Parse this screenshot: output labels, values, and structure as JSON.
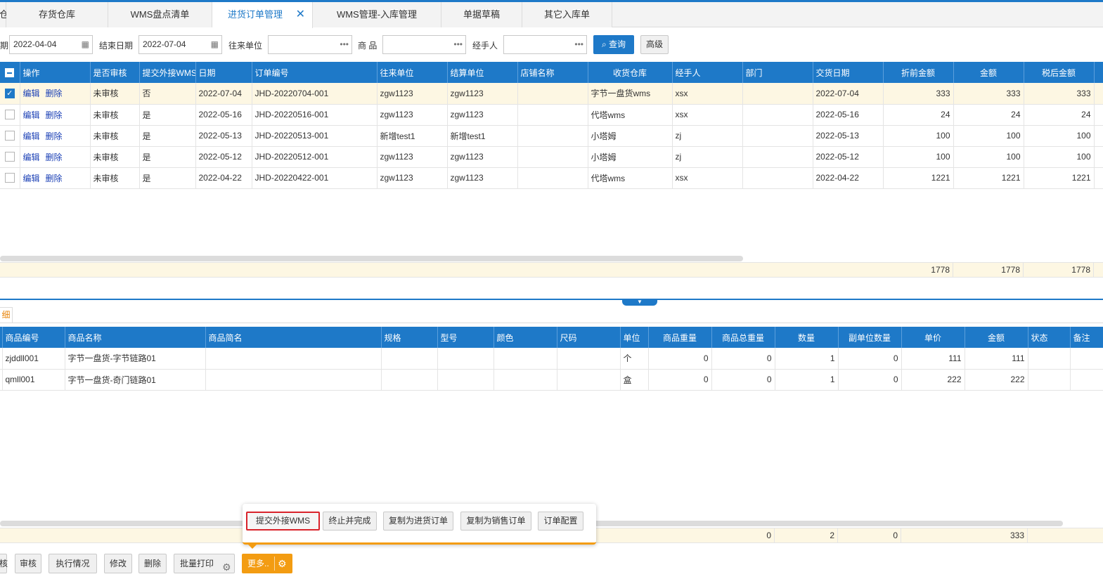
{
  "tabs": [
    {
      "label": "存货仓库"
    },
    {
      "label": "WMS盘点清单"
    },
    {
      "label": "进货订单管理",
      "close": "✕"
    },
    {
      "label": "WMS管理-入库管理"
    },
    {
      "label": "单据草稿"
    },
    {
      "label": "其它入库单"
    }
  ],
  "tab_partial": "仓",
  "filter": {
    "start_label": "期",
    "start_date": "2022-04-04",
    "end_label": "结束日期",
    "end_date": "2022-07-04",
    "partner_label": "往来单位",
    "goods_label": "商 品",
    "handler_label": "经手人",
    "query_label": "查询",
    "advanced_label": "高级"
  },
  "main_grid": {
    "headers": [
      "操作",
      "是否审核",
      "提交外接WMS",
      "日期",
      "订单编号",
      "往来单位",
      "结算单位",
      "店铺名称",
      "收货仓库",
      "经手人",
      "部门",
      "交货日期",
      "折前金额",
      "金额",
      "税后金额"
    ],
    "edit_label": "编辑",
    "delete_label": "删除",
    "rows": [
      {
        "checked": true,
        "audit": "未审核",
        "wms": "否",
        "date": "2022-07-04",
        "order_no": "JHD-20220704-001",
        "partner": "zgw1123",
        "settle": "zgw1123",
        "shop": "",
        "warehouse": "字节一盘货wms",
        "handler": "xsx",
        "dept": "",
        "delivery": "2022-07-04",
        "pre_amount": "333",
        "amount": "333",
        "tax_amount": "333"
      },
      {
        "checked": false,
        "audit": "未审核",
        "wms": "是",
        "date": "2022-05-16",
        "order_no": "JHD-20220516-001",
        "partner": "zgw1123",
        "settle": "zgw1123",
        "shop": "",
        "warehouse": "代塔wms",
        "handler": "xsx",
        "dept": "",
        "delivery": "2022-05-16",
        "pre_amount": "24",
        "amount": "24",
        "tax_amount": "24"
      },
      {
        "checked": false,
        "audit": "未审核",
        "wms": "是",
        "date": "2022-05-13",
        "order_no": "JHD-20220513-001",
        "partner": "新增test1",
        "settle": "新增test1",
        "shop": "",
        "warehouse": "小塔姆",
        "handler": "zj",
        "dept": "",
        "delivery": "2022-05-13",
        "pre_amount": "100",
        "amount": "100",
        "tax_amount": "100"
      },
      {
        "checked": false,
        "audit": "未审核",
        "wms": "是",
        "date": "2022-05-12",
        "order_no": "JHD-20220512-001",
        "partner": "zgw1123",
        "settle": "zgw1123",
        "shop": "",
        "warehouse": "小塔姆",
        "handler": "zj",
        "dept": "",
        "delivery": "2022-05-12",
        "pre_amount": "100",
        "amount": "100",
        "tax_amount": "100"
      },
      {
        "checked": false,
        "audit": "未审核",
        "wms": "是",
        "date": "2022-04-22",
        "order_no": "JHD-20220422-001",
        "partner": "zgw1123",
        "settle": "zgw1123",
        "shop": "",
        "warehouse": "代塔wms",
        "handler": "xsx",
        "dept": "",
        "delivery": "2022-04-22",
        "pre_amount": "1221",
        "amount": "1221",
        "tax_amount": "1221"
      }
    ],
    "totals": {
      "pre_amount": "1778",
      "amount": "1778",
      "tax_amount": "1778"
    }
  },
  "detail_tab_label": "细",
  "detail_grid": {
    "headers": [
      "商品编号",
      "商品名称",
      "商品简名",
      "规格",
      "型号",
      "颜色",
      "尺码",
      "单位",
      "商品重量",
      "商品总重量",
      "数量",
      "副单位数量",
      "单价",
      "金额",
      "状态",
      "备注"
    ],
    "rows": [
      {
        "code": "zjddll001",
        "name": "字节一盘货-字节链路01",
        "short": "",
        "spec": "",
        "model": "",
        "color": "",
        "size": "",
        "unit": "个",
        "weight": "0",
        "total_weight": "0",
        "qty": "1",
        "sub_qty": "0",
        "price": "111",
        "amount": "111",
        "status": "",
        "note": ""
      },
      {
        "code": "qmll001",
        "name": "字节一盘货-奇门链路01",
        "short": "",
        "spec": "",
        "model": "",
        "color": "",
        "size": "",
        "unit": "盒",
        "weight": "0",
        "total_weight": "0",
        "qty": "1",
        "sub_qty": "0",
        "price": "222",
        "amount": "222",
        "status": "",
        "note": ""
      }
    ],
    "totals": {
      "total_weight": "0",
      "qty": "2",
      "sub_qty": "0",
      "amount": "333"
    }
  },
  "popup": {
    "buttons": [
      "提交外接WMS",
      "终止并完成",
      "复制为进货订单",
      "复制为销售订单",
      "订单配置"
    ]
  },
  "toolbar": {
    "partial": "核",
    "audit": "审核",
    "execution": "执行情况",
    "modify": "修改",
    "delete": "删除",
    "batch_print": "批量打印",
    "more": "更多.."
  },
  "colors": {
    "primary": "#1e79c8",
    "orange": "#f39c12",
    "highlight_border": "#d9232b",
    "selected_row": "#fdf7e3"
  }
}
